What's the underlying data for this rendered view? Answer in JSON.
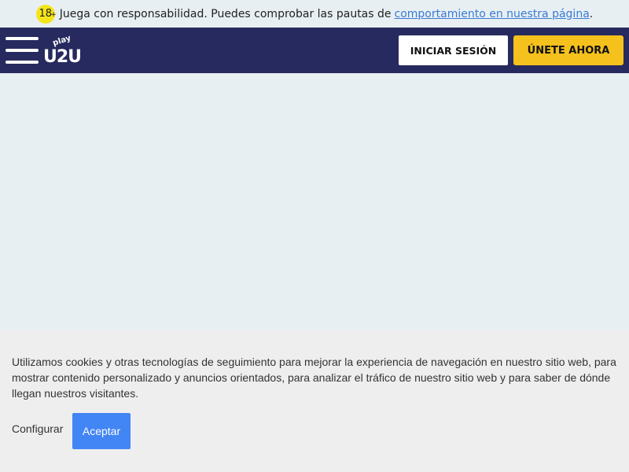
{
  "banner": {
    "age_badge": "18",
    "age_plus": "+",
    "text": "Juega con responsabilidad. Puedes comprobar las pautas de",
    "link_text": "comportamiento en nuestra página",
    "period": "."
  },
  "header": {
    "logo_text_top": "play",
    "logo_text_main": "U2U",
    "login_label": "INICIAR SESIÓN",
    "join_label": "ÚNETE AHORA",
    "colors": {
      "bg": "#272a5e",
      "join": "#f5c11d"
    }
  },
  "cookie": {
    "text": "Utilizamos cookies y otras tecnologías de seguimiento para mejorar la experiencia de navegación en nuestro sitio web, para mostrar contenido personalizado y anuncios orientados, para analizar el tráfico de nuestro sitio web y para saber de dónde llegan nuestros visitantes.",
    "configure_label": "Configurar",
    "accept_label": "Aceptar",
    "accent": "#4285f4"
  }
}
